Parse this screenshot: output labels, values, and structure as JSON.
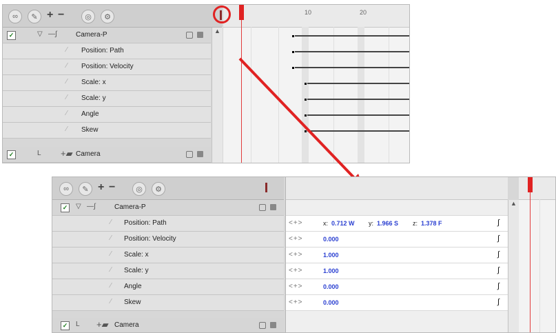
{
  "top_view": {
    "ruler": {
      "label_10": "10",
      "label_20": "20"
    },
    "layers": [
      {
        "name": "Camera-P",
        "checked": true
      },
      {
        "name": "Position: Path"
      },
      {
        "name": "Position: Velocity"
      },
      {
        "name": "Scale: x"
      },
      {
        "name": "Scale: y"
      },
      {
        "name": "Angle"
      },
      {
        "name": "Skew"
      },
      {
        "name": "Camera",
        "checked": true
      }
    ]
  },
  "bottom_view": {
    "layers": [
      {
        "name": "Camera-P",
        "checked": true
      },
      {
        "name": "Position: Path"
      },
      {
        "name": "Position: Velocity"
      },
      {
        "name": "Scale: x"
      },
      {
        "name": "Scale: y"
      },
      {
        "name": "Angle"
      },
      {
        "name": "Skew"
      },
      {
        "name": "Camera",
        "checked": true
      }
    ],
    "functions": [
      {
        "x_label": "x:",
        "x_value": "0.712 W",
        "y_label": "y:",
        "y_value": "1.966 S",
        "z_label": "z:",
        "z_value": "1.378 F"
      },
      {
        "value": "0.000"
      },
      {
        "value": "1.000"
      },
      {
        "value": "1.000"
      },
      {
        "value": "0.000"
      },
      {
        "value": "0.000"
      }
    ],
    "arrows_text": "<+>"
  },
  "colors": {
    "highlight_red": "#e02222",
    "value_blue": "#2a3fd1"
  }
}
